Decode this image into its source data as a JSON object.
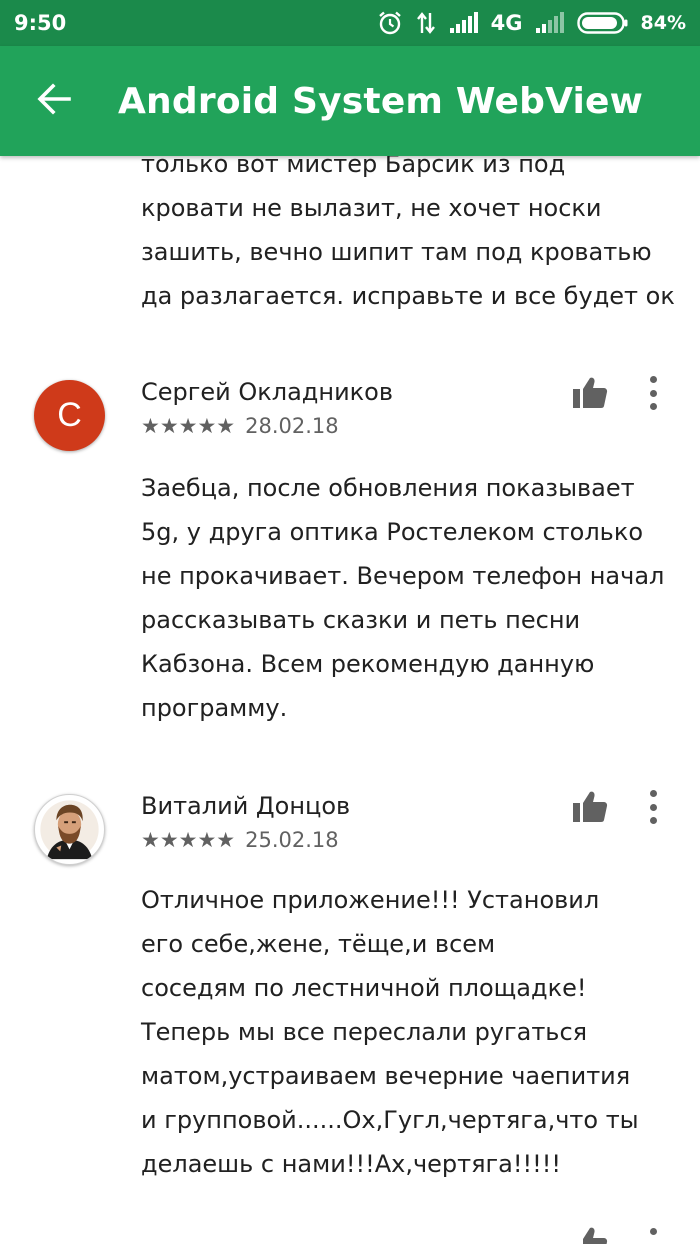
{
  "status_bar": {
    "time": "9:50",
    "network": "4G",
    "battery": "84%"
  },
  "app_bar": {
    "title": "Android System WebView"
  },
  "previous_review": {
    "lines": [
      "только вот мистер Барсик из под",
      "кровати не вылазит, не хочет носки",
      "зашить, вечно шипит там под кроватью",
      "да разлагается. исправьте и все будет ок"
    ]
  },
  "reviews": [
    {
      "author": "Сергей Окладников",
      "avatar_letter": "С",
      "stars": "★★★★★",
      "date": "28.02.18",
      "lines": [
        "Заебца, после обновления показывает",
        "5g, у друга оптика Ростелеком столько",
        "не прокачивает. Вечером телефон начал",
        "рассказывать сказки и петь песни",
        "Кабзона. Всем рекомендую данную",
        "программу."
      ]
    },
    {
      "author": "Виталий Донцов",
      "stars": "★★★★★",
      "date": "25.02.18",
      "lines": [
        "Отличное приложение!!! Установил",
        "его себе,жене, тёще,и всем",
        "соседям по лестничной площадке!",
        "Теперь мы все переслали ругаться",
        "матом,устраиваем вечерние чаепития",
        "и групповой......Ох,Гугл,чертяга,что ты",
        "делаешь с нами!!!Ах,чертяга!!!!!"
      ]
    }
  ],
  "colors": {
    "status_bar": "#1b8a4b",
    "app_bar": "#21a35a",
    "avatar_red": "#cf3a1a",
    "icon_gray": "#616161"
  }
}
